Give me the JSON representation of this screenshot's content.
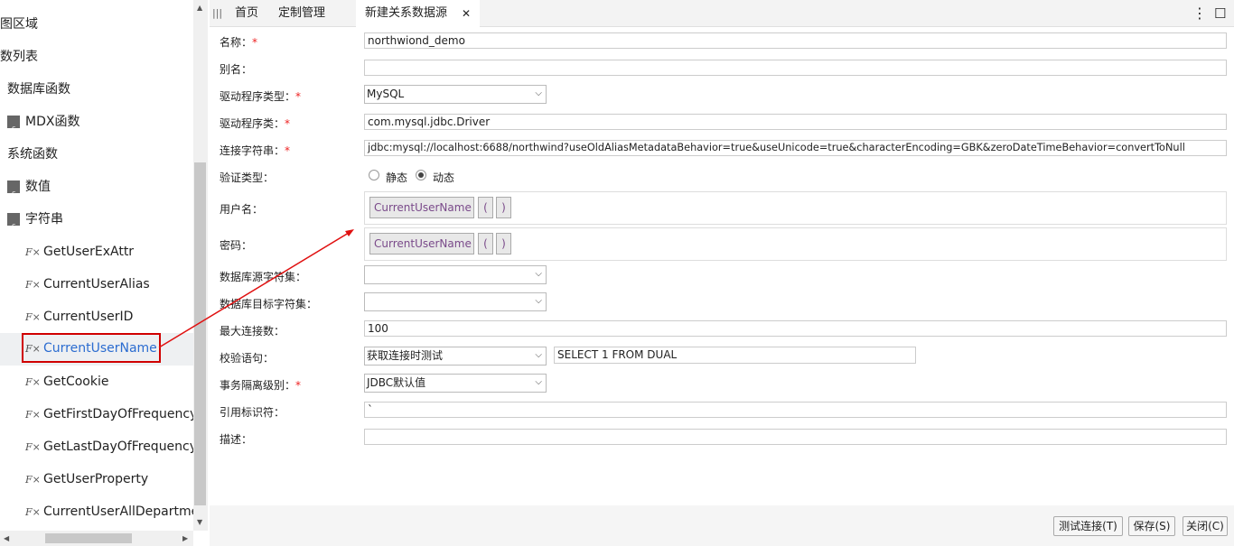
{
  "tree": {
    "items": [
      {
        "label": "图区域",
        "icon": "none"
      },
      {
        "label": "数列表",
        "icon": "none"
      },
      {
        "label": "数据库函数",
        "icon": "none"
      },
      {
        "label": "MDX函数",
        "icon": "function-folder-icon"
      },
      {
        "label": "系统函数",
        "icon": "none"
      },
      {
        "label": "数值",
        "icon": "function-folder-icon"
      },
      {
        "label": "字符串",
        "icon": "function-folder-icon"
      },
      {
        "label": "GetUserExAttr",
        "icon": "fx-icon"
      },
      {
        "label": "CurrentUserAlias",
        "icon": "fx-icon"
      },
      {
        "label": "CurrentUserID",
        "icon": "fx-icon"
      },
      {
        "label": "CurrentUserName",
        "icon": "fx-icon"
      },
      {
        "label": "GetCookie",
        "icon": "fx-icon"
      },
      {
        "label": "GetFirstDayOfFrequencyI",
        "icon": "fx-icon"
      },
      {
        "label": "GetLastDayOfFrequencyF",
        "icon": "fx-icon"
      },
      {
        "label": "GetUserProperty",
        "icon": "fx-icon"
      },
      {
        "label": "CurrentUserAllDepartme",
        "icon": "fx-icon"
      }
    ],
    "fx_glyph": "F×"
  },
  "tabs": {
    "menu_glyph": "|||",
    "home": "首页",
    "custom": "定制管理",
    "active": "新建关系数据源",
    "close": "✕",
    "more": "⋮",
    "maximize": "☐"
  },
  "form": {
    "name_label": "名称：",
    "name_value": "northwiond_demo",
    "alias_label": "别名：",
    "alias_value": "",
    "driver_type_label": "驱动程序类型：",
    "driver_type_value": "MySQL",
    "driver_class_label": "驱动程序类：",
    "driver_class_value": "com.mysql.jdbc.Driver",
    "conn_label": "连接字符串：",
    "conn_value": "jdbc:mysql://localhost:6688/northwind?useOldAliasMetadataBehavior=true&useUnicode=true&characterEncoding=GBK&zeroDateTimeBehavior=convertToNull",
    "auth_label": "验证类型：",
    "auth_static": "静态",
    "auth_dynamic": "动态",
    "user_label": "用户名：",
    "pwd_label": "密码：",
    "chip_func": "CurrentUserName",
    "chip_open": "(",
    "chip_close": ")",
    "src_charset_label": "数据库源字符集：",
    "src_charset_value": "",
    "tgt_charset_label": "数据库目标字符集：",
    "tgt_charset_value": "",
    "maxconn_label": "最大连接数：",
    "maxconn_value": "100",
    "validate_label": "校验语句：",
    "validate_mode": "获取连接时测试",
    "validate_sql": "SELECT 1 FROM DUAL",
    "isolation_label": "事务隔离级别：",
    "isolation_value": "JDBC默认值",
    "quote_label": "引用标识符：",
    "quote_value": "`",
    "desc_label": "描述：",
    "desc_value": "",
    "required_mark": "*"
  },
  "buttons": {
    "test": "测试连接(T)",
    "save": "保存(S)",
    "close": "关闭(C)"
  },
  "colors": {
    "highlight_border": "#d00000",
    "arrow": "#e01010",
    "selected_text": "#2b6cd0",
    "chip_text": "#7a4a8a"
  }
}
